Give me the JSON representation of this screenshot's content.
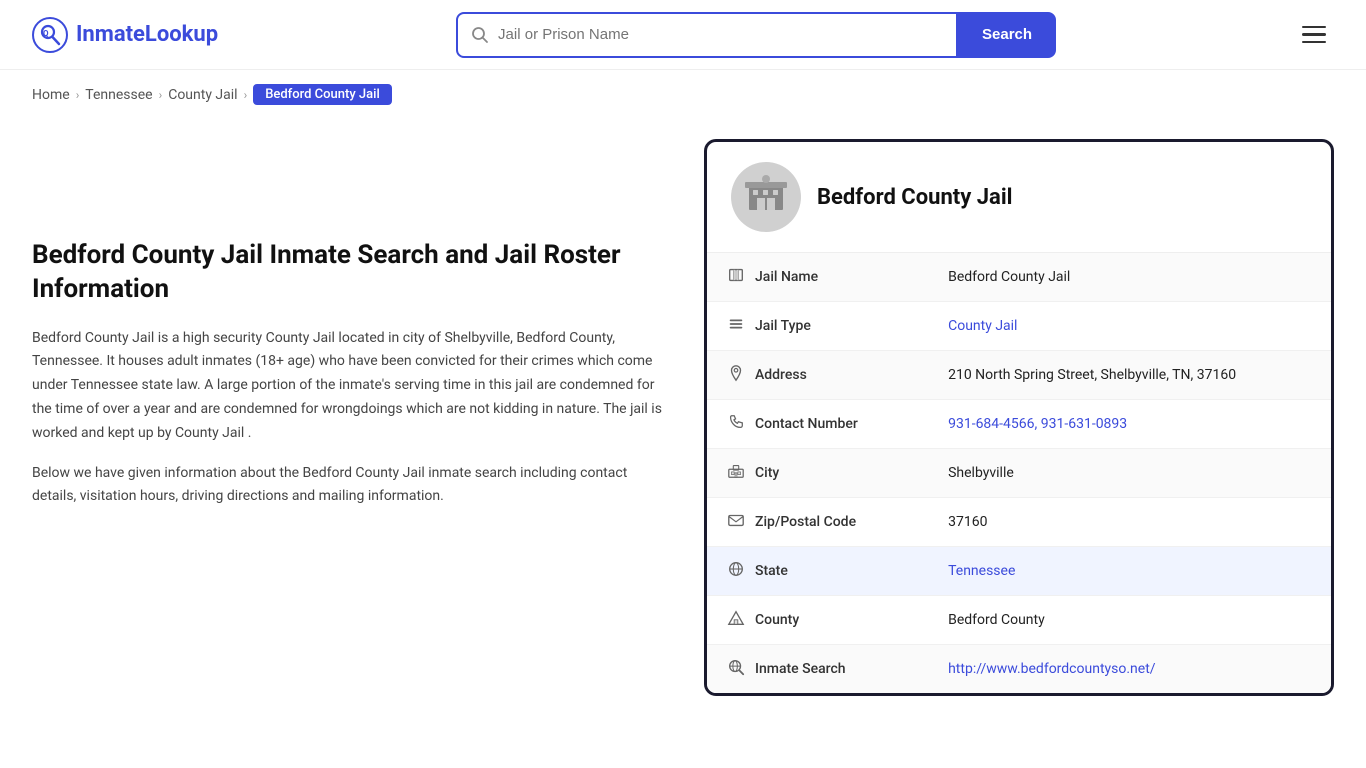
{
  "header": {
    "logo_text_part1": "Inmate",
    "logo_text_part2": "Lookup",
    "search_placeholder": "Jail or Prison Name",
    "search_button_label": "Search"
  },
  "breadcrumb": {
    "home": "Home",
    "state": "Tennessee",
    "type": "County Jail",
    "current": "Bedford County Jail"
  },
  "left": {
    "heading": "Bedford County Jail Inmate Search and Jail Roster Information",
    "para1": "Bedford County Jail is a high security County Jail located in city of Shelbyville, Bedford County, Tennessee. It houses adult inmates (18+ age) who have been convicted for their crimes which come under Tennessee state law. A large portion of the inmate's serving time in this jail are condemned for the time of over a year and are condemned for wrongdoings which are not kidding in nature. The jail is worked and kept up by County Jail .",
    "para2": "Below we have given information about the Bedford County Jail inmate search including contact details, visitation hours, driving directions and mailing information."
  },
  "card": {
    "title": "Bedford County Jail",
    "rows": [
      {
        "icon": "jail-icon",
        "label": "Jail Name",
        "value": "Bedford County Jail",
        "link": false
      },
      {
        "icon": "list-icon",
        "label": "Jail Type",
        "value": "County Jail",
        "link": true,
        "href": "#"
      },
      {
        "icon": "pin-icon",
        "label": "Address",
        "value": "210 North Spring Street, Shelbyville, TN, 37160",
        "link": false
      },
      {
        "icon": "phone-icon",
        "label": "Contact Number",
        "value": "931-684-4566, 931-631-0893",
        "link": true,
        "href": "tel:9316844566"
      },
      {
        "icon": "city-icon",
        "label": "City",
        "value": "Shelbyville",
        "link": false
      },
      {
        "icon": "mail-icon",
        "label": "Zip/Postal Code",
        "value": "37160",
        "link": false
      },
      {
        "icon": "globe-icon",
        "label": "State",
        "value": "Tennessee",
        "link": true,
        "href": "#",
        "highlight": true
      },
      {
        "icon": "county-icon",
        "label": "County",
        "value": "Bedford County",
        "link": false
      },
      {
        "icon": "search-globe-icon",
        "label": "Inmate Search",
        "value": "http://www.bedfordcountyso.net/",
        "link": true,
        "href": "http://www.bedfordcountyso.net/"
      }
    ]
  }
}
